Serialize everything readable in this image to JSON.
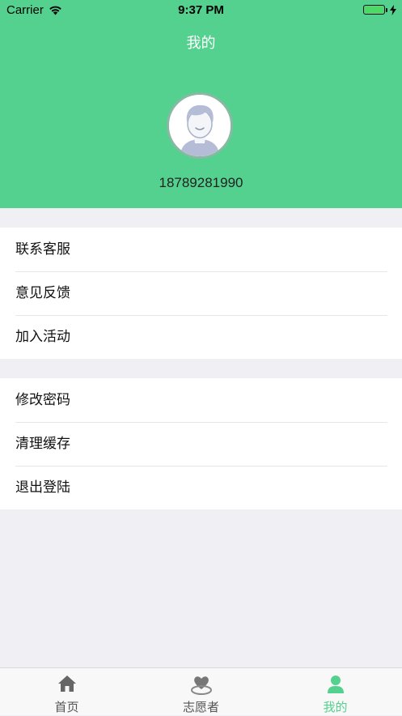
{
  "status_bar": {
    "carrier": "Carrier",
    "time": "9:37 PM"
  },
  "header": {
    "title": "我的",
    "phone": "18789281990"
  },
  "menu_group_1": [
    {
      "label": "联系客服"
    },
    {
      "label": "意见反馈"
    },
    {
      "label": "加入活动"
    }
  ],
  "menu_group_2": [
    {
      "label": "修改密码"
    },
    {
      "label": "清理缓存"
    },
    {
      "label": "退出登陆"
    }
  ],
  "tabbar": {
    "tabs": [
      {
        "label": "首页",
        "icon": "home-icon"
      },
      {
        "label": "志愿者",
        "icon": "volunteer-heart-icon"
      },
      {
        "label": "我的",
        "icon": "user-icon",
        "active": true
      }
    ]
  },
  "colors": {
    "accent": "#55d18f",
    "background": "#efeff4"
  }
}
